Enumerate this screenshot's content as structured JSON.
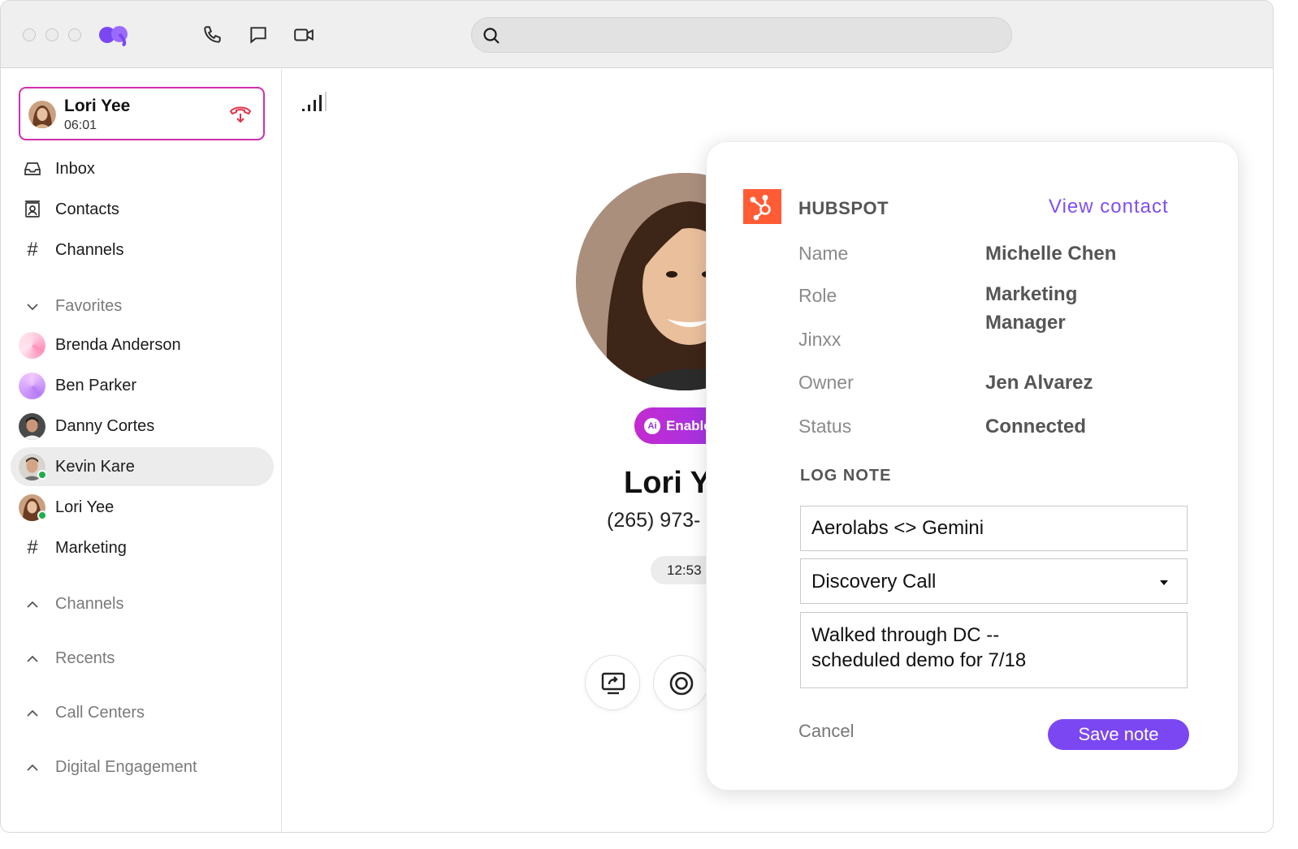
{
  "window": {
    "titlebar": {
      "icons": [
        "phone-icon",
        "chat-icon",
        "video-icon"
      ],
      "search": {
        "value": "",
        "placeholder": ""
      }
    }
  },
  "sidebar": {
    "active_call": {
      "name": "Lori Yee",
      "duration": "06:01"
    },
    "nav": [
      {
        "label": "Inbox",
        "icon": "inbox-icon"
      },
      {
        "label": "Contacts",
        "icon": "contacts-icon"
      },
      {
        "label": "Channels",
        "icon": "hash-icon"
      }
    ],
    "favorites": {
      "label": "Favorites",
      "items": [
        {
          "label": "Brenda Anderson",
          "online": false
        },
        {
          "label": "Ben Parker",
          "online": false
        },
        {
          "label": "Danny Cortes",
          "online": false
        },
        {
          "label": "Kevin Kare",
          "online": true,
          "selected": true
        },
        {
          "label": "Lori Yee",
          "online": true
        },
        {
          "label": "Marketing",
          "icon": "hash-icon"
        }
      ]
    },
    "sections": [
      "Channels",
      "Recents",
      "Call Centers",
      "Digital Engagement"
    ]
  },
  "call": {
    "ai_pill": "Enable",
    "ai_badge": "Ai",
    "name": "Lori Y",
    "phone": "(265) 973-",
    "timer": "12:53"
  },
  "hubspot": {
    "title": "HUBSPOT",
    "view_contact": "View contact",
    "fields": [
      {
        "label": "Name",
        "value": "Michelle Chen"
      },
      {
        "label": "Role",
        "value": "Marketing Manager"
      },
      {
        "label": "Jinxx",
        "value": ""
      },
      {
        "label": "Owner",
        "value": "Jen Alvarez"
      },
      {
        "label": "Status",
        "value": "Connected"
      }
    ],
    "log_note": {
      "title": "LOG NOTE",
      "subject": "Aerolabs <> Gemini",
      "call_type": "Discovery Call",
      "note": "Walked through DC --\nscheduled demo for 7/18",
      "cancel": "Cancel",
      "save": "Save note"
    }
  },
  "colors": {
    "accent": "#7b47f2",
    "hubspot": "#ff5c35",
    "active_call_border": "#d12fae",
    "online": "#1fae4a"
  }
}
